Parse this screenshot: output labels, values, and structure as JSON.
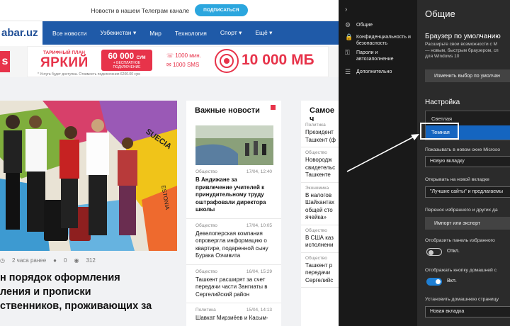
{
  "telegram_bar": {
    "text": "Новости в нашем Телеграм канале",
    "button": "ПОДПИСАТЬСЯ"
  },
  "header": {
    "logo": "abar.uz",
    "nav": [
      "Все новости",
      "Узбекистан ▾",
      "Мир",
      "Технология",
      "Спорт ▾",
      "Ещё ▾"
    ]
  },
  "banner": {
    "left_letter": "s",
    "tariff_label": "ТАРИФНЫЙ ПЛАН",
    "tariff_name": "ЯРКИЙ",
    "price": "60 000",
    "price_unit": "СУМ",
    "price_sub": "+ БЕСПЛАТНОЕ ПОДКЛЮЧЕНИЕ",
    "minutes": "1000 мин.",
    "sms": "1000 SMS",
    "mb": "10 000 МБ",
    "fine_print": "* Услуга будет доступна. Стоимость подключения 6200.00 сум"
  },
  "main_article": {
    "image_labels": [
      "SUECIA",
      "ESTONIA"
    ],
    "time": "2 часа ранее",
    "comments": "0",
    "views": "312",
    "headline": "н порядок оформления\nления и прописки\nственников, проживающих за"
  },
  "important": {
    "title": "Важные новости",
    "items": [
      {
        "category": "Общество",
        "date": "17/04, 12:40",
        "title": "В Андижане за привлечение учителей к принудительному труду оштрафовали директора школы",
        "bold": true
      },
      {
        "category": "Общество",
        "date": "17/04, 10:05",
        "title": "Девелоперская компания опровергла информацию о квартире, подаренной сыну Бурака Озчивита",
        "bold": false
      },
      {
        "category": "Общество",
        "date": "16/04, 15:29",
        "title": "Ташкент расширят за счет передачи части Зангиаты в Сергелийский район",
        "bold": false
      },
      {
        "category": "Политика",
        "date": "15/04, 14:13",
        "title": "Шавкат Мирзиёев и Касым-",
        "bold": false
      }
    ]
  },
  "most": {
    "title": "Самое ч",
    "items": [
      {
        "category": "Политика",
        "title": "Президент\nТашкент (ф"
      },
      {
        "category": "Общество",
        "title": "Новородж\nсвидетельс\nТашкенте"
      },
      {
        "category": "Экономика",
        "title": "В налогов\nШайхантах\nобщей сто\nячейка»"
      },
      {
        "category": "Общество",
        "title": "В США каз\nисполнени"
      },
      {
        "category": "Общество",
        "title": "Ташкент р\nпередачи\nСергелийс"
      }
    ]
  },
  "edge_nav": {
    "chevron": "›",
    "items": [
      {
        "icon": "gear-icon",
        "glyph": "⚙",
        "label": "Общие"
      },
      {
        "icon": "lock-icon",
        "glyph": "🔒",
        "label": "Конфиденциальность и\nбезопасность"
      },
      {
        "icon": "key-icon",
        "glyph": "⚿",
        "label": "Пароли и\nавтозаполнение"
      },
      {
        "icon": "sliders-icon",
        "glyph": "☰",
        "label": "Дополнительно"
      }
    ]
  },
  "edge_panel": {
    "title": "Общие",
    "default_heading": "Браузер по умолчанию",
    "default_desc": "Расширьте свои возможности с M\n— новым, быстрым браузером, сп\nдля Windows 10",
    "default_button": "Изменить выбор по умолчан",
    "custom_heading": "Настройка",
    "theme_options": [
      "Светлая",
      "Темная"
    ],
    "open_label": "Показывать в новом окне Microso",
    "open_value": "Новую вкладку",
    "newtab_label": "Открывать на новой вкладке",
    "newtab_value": "\"Лучшие сайты\" и предлагаемы",
    "transfer_label": "Перенос избранного и других да",
    "transfer_button": "Импорт или экспорт",
    "favbar_label": "Отобразить панель избранного",
    "favbar_state": "Откл.",
    "home_label": "Отображать кнопку домашней с",
    "home_state": "Вкл.",
    "homepage_label": "Установить домашнюю страницу",
    "homepage_value": "Новая вкладка"
  }
}
